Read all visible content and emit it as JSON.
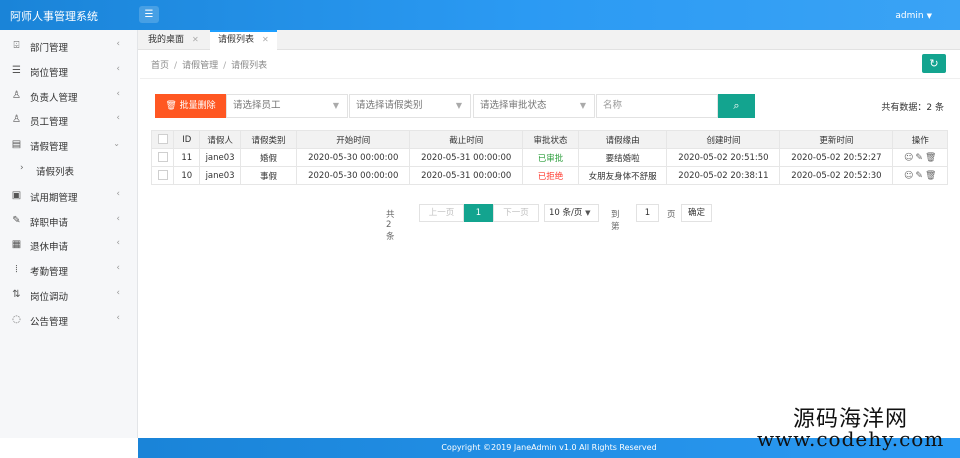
{
  "header": {
    "app_title": "阿师人事管理系统",
    "menu_icon": "hamburger-icon",
    "user": "admin"
  },
  "sidebar": {
    "items": [
      {
        "label": "部门管理",
        "icon": "department-icon"
      },
      {
        "label": "岗位管理",
        "icon": "post-icon"
      },
      {
        "label": "负责人管理",
        "icon": "person-icon"
      },
      {
        "label": "员工管理",
        "icon": "person-icon"
      },
      {
        "label": "请假管理",
        "icon": "doc-icon",
        "expanded": true
      },
      {
        "label": "请假列表",
        "sub": true
      },
      {
        "label": "试用期管理",
        "icon": "doc-icon"
      },
      {
        "label": "辞职申请",
        "icon": "pen-icon"
      },
      {
        "label": "退休申请",
        "icon": "calendar-icon"
      },
      {
        "label": "考勤管理",
        "icon": "bars-icon"
      },
      {
        "label": "岗位调动",
        "icon": "transfer-icon"
      },
      {
        "label": "公告管理",
        "icon": "notice-icon"
      }
    ]
  },
  "tabs": [
    {
      "label": "我的桌面",
      "active": false
    },
    {
      "label": "请假列表",
      "active": true
    }
  ],
  "breadcrumb": [
    "首页",
    "请假管理",
    "请假列表"
  ],
  "toolbar": {
    "batch_delete": "批量删除",
    "employee_placeholder": "请选择员工",
    "type_placeholder": "请选择请假类别",
    "status_placeholder": "请选择审批状态",
    "name_placeholder": "名称",
    "total_text": "共有数据：2 条"
  },
  "table": {
    "headers": [
      "",
      "ID",
      "请假人",
      "请假类别",
      "开始时间",
      "截止时间",
      "审批状态",
      "请假缘由",
      "创建时间",
      "更新时间",
      "操作"
    ],
    "rows": [
      {
        "id": "11",
        "person": "jane03",
        "type": "婚假",
        "start": "2020-05-30 00:00:00",
        "end": "2020-05-31 00:00:00",
        "status": "已审批",
        "status_kind": "approved",
        "reason": "要结婚啦",
        "created": "2020-05-02 20:51:50",
        "updated": "2020-05-02 20:52:27"
      },
      {
        "id": "10",
        "person": "jane03",
        "type": "事假",
        "start": "2020-05-30 00:00:00",
        "end": "2020-05-31 00:00:00",
        "status": "已拒绝",
        "status_kind": "rejected",
        "reason": "女朋友身体不舒服",
        "created": "2020-05-02 20:38:11",
        "updated": "2020-05-02 20:52:30"
      }
    ]
  },
  "pager": {
    "total": "共 2 条",
    "prev": "上一页",
    "current": "1",
    "next": "下一页",
    "page_size": "10 条/页",
    "goto_label": "到第",
    "goto_value": "1",
    "page_unit": "页",
    "confirm": "确定"
  },
  "footer": {
    "copyright": "Copyright ©2019 JaneAdmin v1.0 All Rights Reserved"
  },
  "watermark": {
    "line1": "源码海洋网",
    "line2": "www.codehy.com"
  },
  "colors": {
    "header_blue": "#1a84d8",
    "teal": "#13a48f",
    "danger": "#ff5722",
    "approved": "#2a9d3a",
    "rejected": "#ff3b30"
  }
}
